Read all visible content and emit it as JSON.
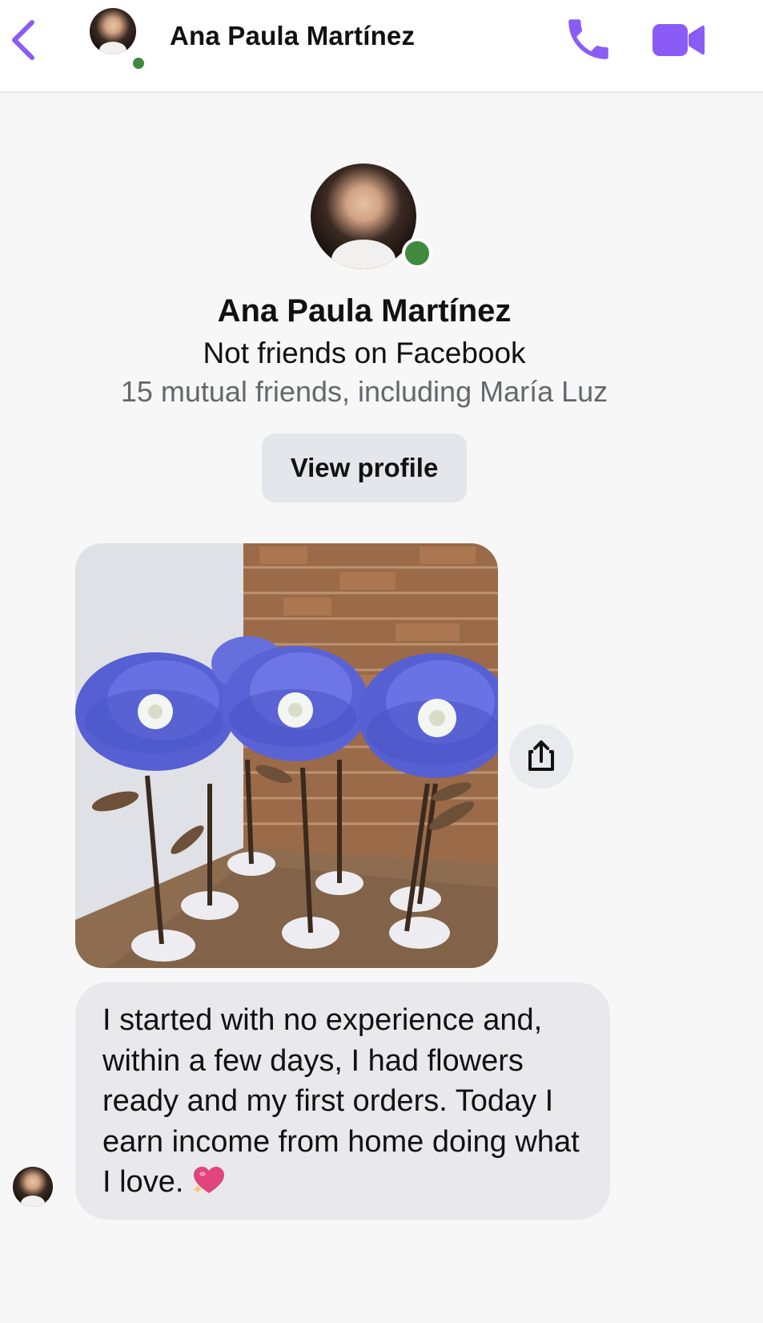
{
  "header": {
    "contact_name": "Ana Paula Martínez",
    "back_icon": "chevron-left-icon",
    "call_icon": "phone-icon",
    "video_icon": "video-camera-icon",
    "accent_color": "#8a5cf5",
    "online_color": "#3f8a3f"
  },
  "profile": {
    "name": "Ana Paula Martínez",
    "relationship": "Not friends on Facebook",
    "mutual": "15 mutual friends, including María Luz",
    "view_profile_label": "View profile"
  },
  "messages": {
    "photo_share_icon": "share-upload-icon",
    "text": "I started with no experience and, within a few days, I had flowers ready and my first orders.  Today I earn income from home doing what I love.",
    "emoji_icon": "sparkling-heart-icon"
  }
}
